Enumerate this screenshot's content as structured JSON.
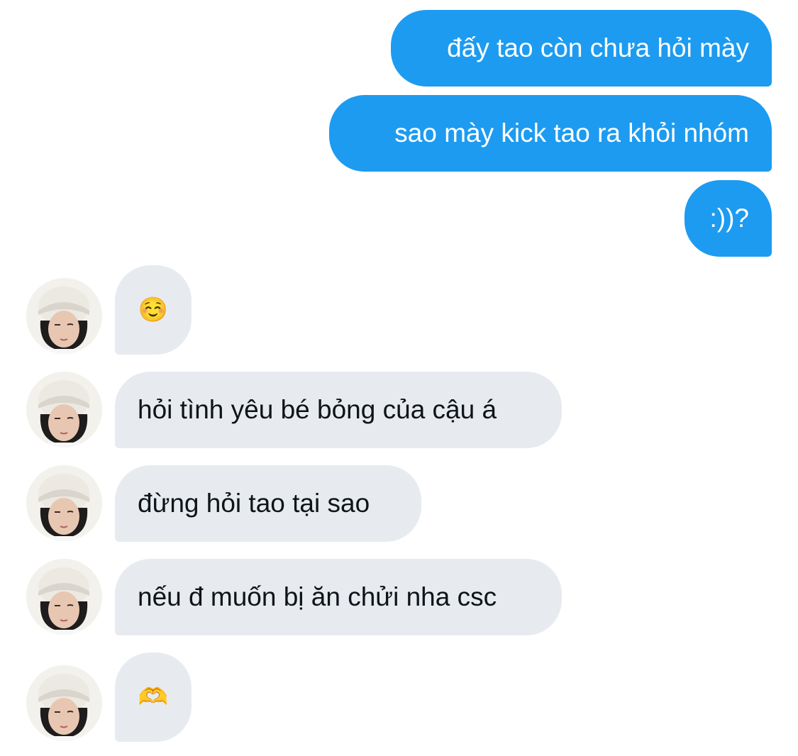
{
  "conversation": {
    "sent": [
      {
        "text": "đấy tao còn chưa hỏi mày"
      },
      {
        "text": "sao mày kick tao ra khỏi nhóm"
      },
      {
        "text": ":))?"
      }
    ],
    "received": [
      {
        "text": "☺️",
        "avatar": "avatar-photo"
      },
      {
        "text": "hỏi tình yêu bé bỏng của cậu á",
        "avatar": "avatar-photo"
      },
      {
        "text": "đừng hỏi tao tại sao",
        "avatar": "avatar-photo"
      },
      {
        "text": "nếu đ muốn bị ăn chửi nha csc",
        "avatar": "avatar-photo"
      },
      {
        "text": "🫶",
        "avatar": "avatar-photo"
      }
    ]
  },
  "colors": {
    "sent_bubble": "#1d9bf0",
    "sent_text": "#ffffff",
    "received_bubble": "#e7ebef",
    "received_text": "#0f1419",
    "background": "#ffffff"
  }
}
